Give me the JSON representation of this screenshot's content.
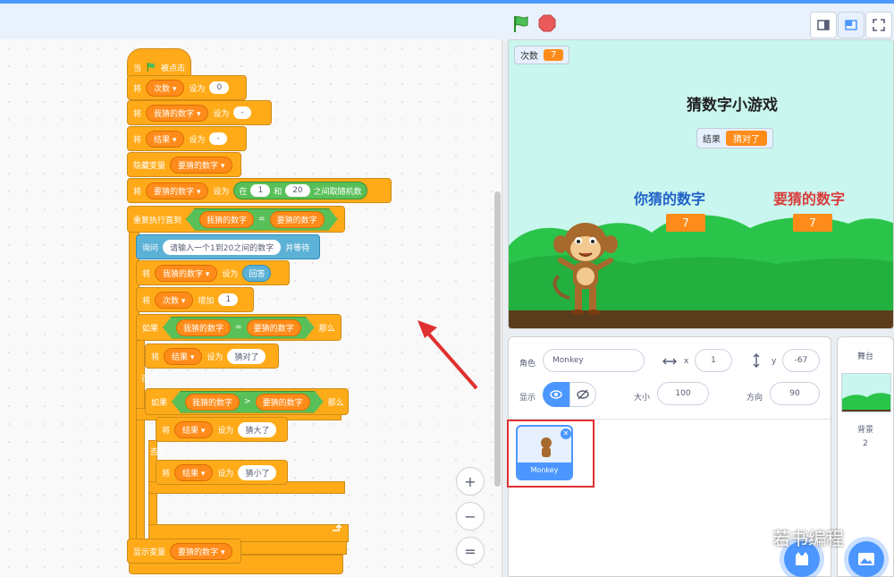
{
  "colors": {
    "accent": "#4c97ff",
    "events": "#ffab19",
    "operators": "#59c059",
    "sensing": "#5cb1d6",
    "annotation": "#e03030"
  },
  "toolbar": {
    "flag_icon": "green-flag-icon",
    "stop_icon": "stop-icon"
  },
  "code": {
    "hat": {
      "label_when": "当",
      "label_clicked": "被点击"
    },
    "b1": {
      "set": "将",
      "var": "次数",
      "to": "设为",
      "value": "0"
    },
    "b2": {
      "set": "将",
      "var": "我猜的数字",
      "to": "设为",
      "value": "-"
    },
    "b3": {
      "set": "将",
      "var": "结果",
      "to": "设为",
      "value": "-"
    },
    "b4": {
      "label": "隐藏变量",
      "var": "要猜的数字"
    },
    "b5": {
      "set": "将",
      "var": "要猜的数字",
      "to": "设为",
      "in": "在",
      "from": "1",
      "and": "和",
      "to_val": "20",
      "rand": "之间取随机数"
    },
    "repeat": {
      "label": "重复执行直到",
      "left": "我猜的数字",
      "eq": "=",
      "right": "要猜的数字"
    },
    "ask": {
      "label": "询问",
      "question": "请输入一个1到20之间的数字",
      "wait": "并等待"
    },
    "b6": {
      "set": "将",
      "var": "我猜的数字",
      "to": "设为",
      "answer": "回答"
    },
    "b7": {
      "set": "将",
      "var": "次数",
      "inc": "增加",
      "value": "1"
    },
    "if1": {
      "if": "如果",
      "left": "我猜的数字",
      "eq": "=",
      "right": "要猜的数字",
      "then": "那么"
    },
    "b8": {
      "set": "将",
      "var": "结果",
      "to": "设为",
      "value": "猜对了"
    },
    "else1": "否则",
    "if2": {
      "if": "如果",
      "left": "我猜的数字",
      "gt": ">",
      "right": "要猜的数字",
      "then": "那么"
    },
    "b9": {
      "set": "将",
      "var": "结果",
      "to": "设为",
      "value": "猜大了"
    },
    "else2": "否则",
    "b10": {
      "set": "将",
      "var": "结果",
      "to": "设为",
      "value": "猜小了"
    },
    "b11": {
      "label": "显示变量",
      "var": "要猜的数字"
    }
  },
  "zoom": {
    "in": "+",
    "out": "−",
    "reset": "="
  },
  "stage": {
    "counter": {
      "label": "次数",
      "value": "7"
    },
    "title": "猜数字小游戏",
    "result": {
      "label": "结果",
      "value": "猜对了"
    },
    "your_guess": {
      "label": "你猜的数字",
      "value": "7"
    },
    "target": {
      "label": "要猜的数字",
      "value": "7"
    }
  },
  "sprite_info": {
    "sprite_label": "角色",
    "sprite_name": "Monkey",
    "x_label": "x",
    "x": "1",
    "y_label": "y",
    "y": "-67",
    "show_label": "显示",
    "size_label": "大小",
    "size": "100",
    "dir_label": "方向",
    "dir": "90"
  },
  "sprites": [
    {
      "name": "Monkey"
    }
  ],
  "stage_pane": {
    "title": "舞台",
    "backdrop_label": "背景",
    "backdrop_count": "2"
  },
  "watermark": "若书编程"
}
